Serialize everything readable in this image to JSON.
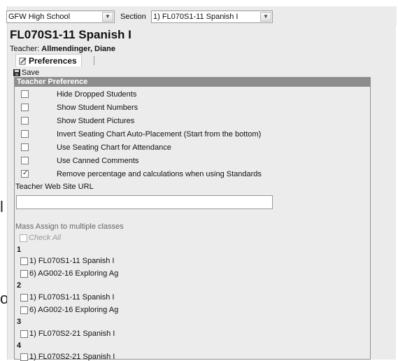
{
  "edge_fragments": [
    "l",
    "o"
  ],
  "toolbar": {
    "school": "GFW High School",
    "section_label": "Section",
    "section_value": "1) FL070S1-11 Spanish I"
  },
  "header": {
    "title": "FL070S1-11 Spanish I",
    "teacher_label": "Teacher:",
    "teacher_name": "Allmendinger, Diane"
  },
  "tab": {
    "label": "Preferences"
  },
  "save_label": "Save",
  "panel": {
    "title": "Teacher Preference",
    "options": [
      {
        "label": "Hide Dropped Students",
        "checked": false
      },
      {
        "label": "Show Student Numbers",
        "checked": false
      },
      {
        "label": "Show Student Pictures",
        "checked": false
      },
      {
        "label": "Invert Seating Chart Auto-Placement (Start from the bottom)",
        "checked": false
      },
      {
        "label": "Use Seating Chart for Attendance",
        "checked": false
      },
      {
        "label": "Use Canned Comments",
        "checked": false
      },
      {
        "label": "Remove percentage and calculations when using Standards",
        "checked": true
      }
    ],
    "web_url_label": "Teacher Web Site URL",
    "web_url_value": "",
    "mass_assign_label": "Mass Assign to multiple classes",
    "check_all_label": "Check All",
    "groups": [
      {
        "number": "1",
        "classes": [
          "1) FL070S1-11 Spanish I",
          "6) AG002-16 Exploring Ag"
        ]
      },
      {
        "number": "2",
        "classes": [
          "1) FL070S1-11 Spanish I",
          "6) AG002-16 Exploring Ag"
        ]
      },
      {
        "number": "3",
        "classes": [
          "1) FL070S2-21 Spanish I"
        ]
      },
      {
        "number": "4",
        "classes": [
          "1) FL070S2-21 Spanish I"
        ]
      }
    ]
  }
}
